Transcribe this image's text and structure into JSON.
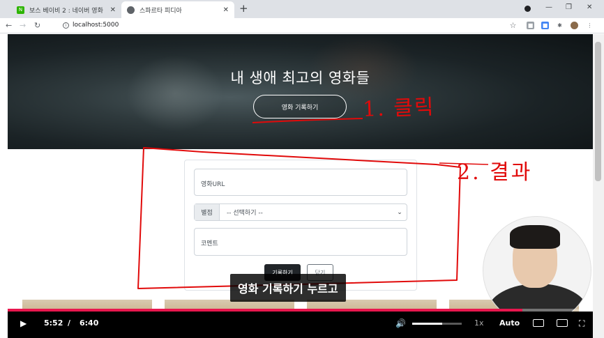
{
  "browser": {
    "tabs": [
      {
        "title": "보스 베이비 2 : 네이버 영화",
        "active": false
      },
      {
        "title": "스파르타 피디아",
        "active": true
      }
    ],
    "url": "localhost:5000"
  },
  "page": {
    "hero_title": "내 생애 최고의 영화들",
    "hero_button": "영화 기록하기",
    "form": {
      "url_placeholder": "영화URL",
      "star_label": "별점",
      "star_select": "-- 선택하기 --",
      "comment_placeholder": "코멘트",
      "save_button": "기록하기",
      "close_button": "닫기"
    }
  },
  "annotations": {
    "step1": "1. 클릭",
    "step2": "2. 결과"
  },
  "player": {
    "caption": "영화 기록하기 누르고",
    "current_time": "5:52",
    "separator": "/",
    "duration": "6:40",
    "progress_fraction": 0.88,
    "volume_fraction": 0.6,
    "speed": "1x",
    "quality": "Auto"
  },
  "colors": {
    "annotation": "#e10a0a",
    "progress": "#e8174e"
  }
}
